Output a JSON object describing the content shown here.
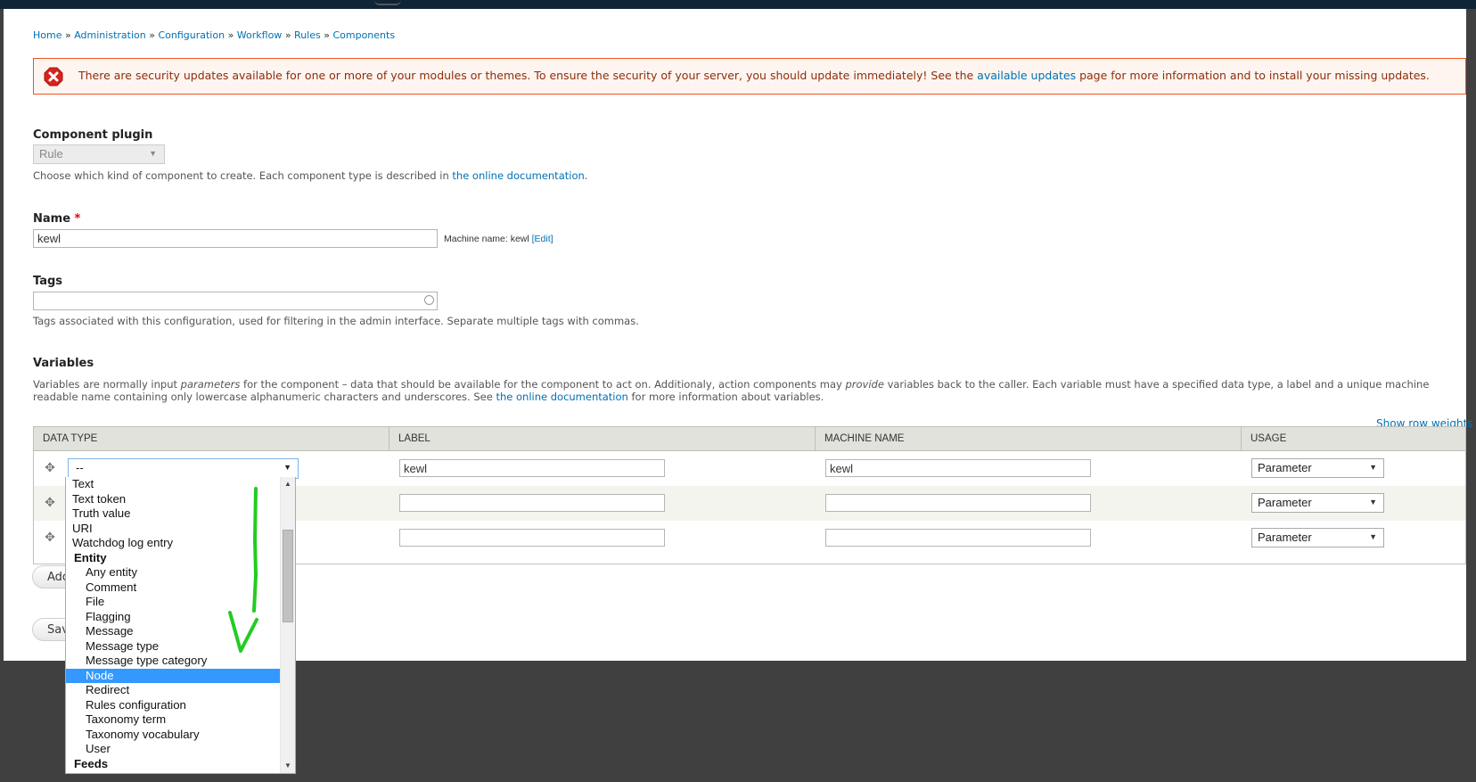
{
  "breadcrumb": [
    {
      "label": "Home"
    },
    {
      "label": "Administration"
    },
    {
      "label": "Configuration"
    },
    {
      "label": "Workflow"
    },
    {
      "label": "Rules"
    },
    {
      "label": "Components"
    }
  ],
  "breadcrumb_separator": "»",
  "alert": {
    "icon": "error-icon",
    "text_before": "There are security updates available for one or more of your modules or themes. To ensure the security of your server, you should update immediately! See the ",
    "link": "available updates",
    "text_after": " page for more information and to install your missing updates."
  },
  "component_plugin": {
    "label": "Component plugin",
    "value": "Rule",
    "help_before": "Choose which kind of component to create. Each component type is described in ",
    "help_link": "the online documentation",
    "help_after": "."
  },
  "name_field": {
    "label": "Name",
    "required_marker": "*",
    "value": "kewl",
    "machine_name_prefix": "Machine name: kewl",
    "edit_link": "[Edit]"
  },
  "tags_field": {
    "label": "Tags",
    "value": "",
    "help": "Tags associated with this configuration, used for filtering in the admin interface. Separate multiple tags with commas."
  },
  "variables": {
    "title": "Variables",
    "desc_1a": "Variables are normally input ",
    "desc_1b": "parameters",
    "desc_1c": " for the component – data that should be available for the component to act on. Additionaly, action components may ",
    "desc_1d": "provide",
    "desc_1e": " variables back to the caller. Each variable must have a specified data type, a label and a unique machine",
    "desc_2a": "readable name containing only lowercase alphanumeric characters and underscores. See ",
    "desc_2_link": "the online documentation",
    "desc_2b": " for more information about variables.",
    "show_row_weights": "Show row weights",
    "columns": [
      "DATA TYPE",
      "LABEL",
      "MACHINE NAME",
      "USAGE"
    ],
    "rows": [
      {
        "data_type": "--",
        "label": "kewl",
        "machine_name": "kewl",
        "usage": "Parameter"
      },
      {
        "data_type": "",
        "label": "",
        "machine_name": "",
        "usage": "Parameter"
      },
      {
        "data_type": "",
        "label": "",
        "machine_name": "",
        "usage": "Parameter"
      }
    ]
  },
  "buttons": {
    "add_more": "Add more",
    "save": "Save"
  },
  "dropdown": {
    "items": [
      {
        "label": "Text",
        "kind": "item"
      },
      {
        "label": "Text token",
        "kind": "item"
      },
      {
        "label": "Truth value",
        "kind": "item"
      },
      {
        "label": "URI",
        "kind": "item"
      },
      {
        "label": "Watchdog log entry",
        "kind": "item"
      },
      {
        "label": "Entity",
        "kind": "group"
      },
      {
        "label": "Any entity",
        "kind": "child"
      },
      {
        "label": "Comment",
        "kind": "child"
      },
      {
        "label": "File",
        "kind": "child"
      },
      {
        "label": "Flagging",
        "kind": "child"
      },
      {
        "label": "Message",
        "kind": "child"
      },
      {
        "label": "Message type",
        "kind": "child"
      },
      {
        "label": "Message type category",
        "kind": "child"
      },
      {
        "label": "Node",
        "kind": "child",
        "selected": true
      },
      {
        "label": "Redirect",
        "kind": "child"
      },
      {
        "label": "Rules configuration",
        "kind": "child"
      },
      {
        "label": "Taxonomy term",
        "kind": "child"
      },
      {
        "label": "Taxonomy vocabulary",
        "kind": "child"
      },
      {
        "label": "User",
        "kind": "child"
      },
      {
        "label": "Feeds",
        "kind": "group"
      }
    ]
  },
  "colors": {
    "link": "#0071b3",
    "alert_border": "#ed541d",
    "alert_bg": "#fef5f1",
    "alert_text": "#8c2e0b",
    "selection": "#3399ff",
    "annotation": "#22cc22"
  }
}
